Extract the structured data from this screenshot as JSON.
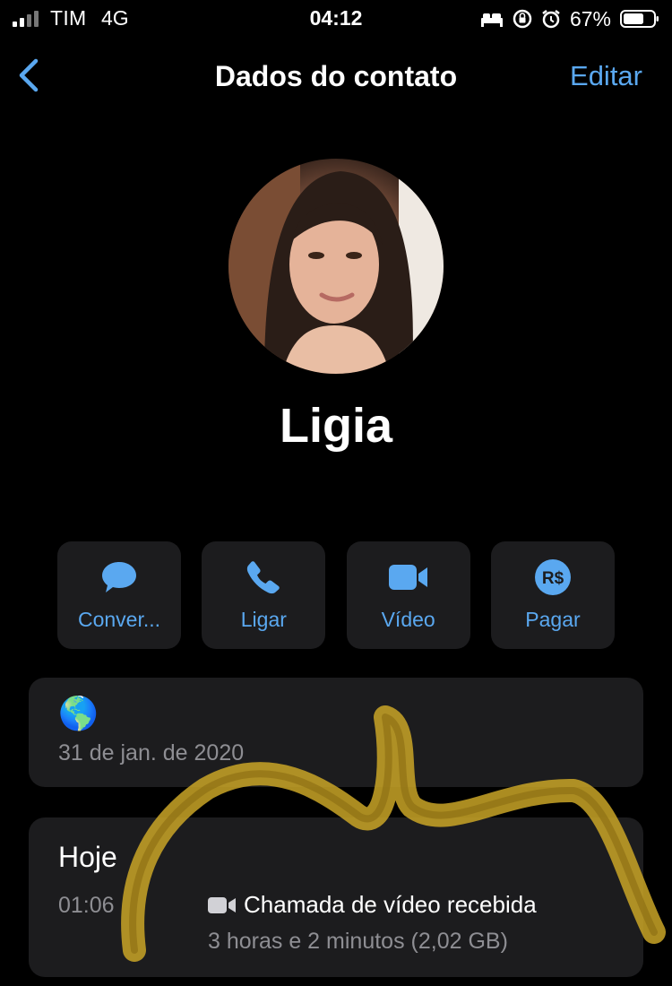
{
  "status_bar": {
    "carrier": "TIM",
    "network": "4G",
    "time": "04:12",
    "battery": "67%",
    "icons": [
      "signal-icon",
      "bed-icon",
      "rotation-lock-icon",
      "alarm-icon",
      "battery-icon"
    ]
  },
  "nav": {
    "back_icon": "chevron-left-icon",
    "title": "Dados do contato",
    "edit_label": "Editar"
  },
  "contact": {
    "name": "Ligia",
    "avatar": "contact-photo"
  },
  "actions": [
    {
      "label": "Conver...",
      "icon": "message-bubble-icon"
    },
    {
      "label": "Ligar",
      "icon": "phone-icon"
    },
    {
      "label": "Vídeo",
      "icon": "video-camera-icon"
    },
    {
      "label": "Pagar",
      "icon": "real-currency-icon",
      "icon_text": "R$"
    }
  ],
  "about": {
    "emoji": "🌎",
    "date": "31 de jan. de 2020"
  },
  "calls": {
    "heading": "Hoje",
    "items": [
      {
        "time": "01:06",
        "type": "Chamada de vídeo recebida",
        "detail": "3 horas e 2 minutos (2,02 GB)",
        "icon": "video-camera-icon"
      }
    ]
  },
  "colors": {
    "accent": "#5aa8f0",
    "card": "#1c1c1e",
    "secondary_text": "#8e8e93",
    "scribble": "#c9a527"
  }
}
